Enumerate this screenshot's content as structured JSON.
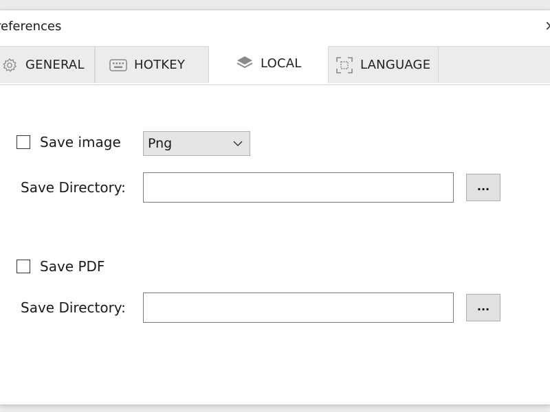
{
  "window": {
    "title": "references",
    "close_glyph": "×"
  },
  "tabs": [
    {
      "label": "GENERAL",
      "icon": "gear-icon"
    },
    {
      "label": "HOTKEY",
      "icon": "keyboard-icon"
    },
    {
      "label": "LOCAL",
      "icon": "layers-icon",
      "active": true
    },
    {
      "label": "LANGUAGE",
      "icon": "scan-icon"
    }
  ],
  "image_section": {
    "checkbox_label": "Save image",
    "checked": false,
    "format_selected": "Png",
    "directory_label": "Save Directory:",
    "directory_value": "",
    "browse_label": "..."
  },
  "pdf_section": {
    "checkbox_label": "Save PDF",
    "checked": false,
    "directory_label": "Save Directory:",
    "directory_value": "",
    "browse_label": "..."
  }
}
